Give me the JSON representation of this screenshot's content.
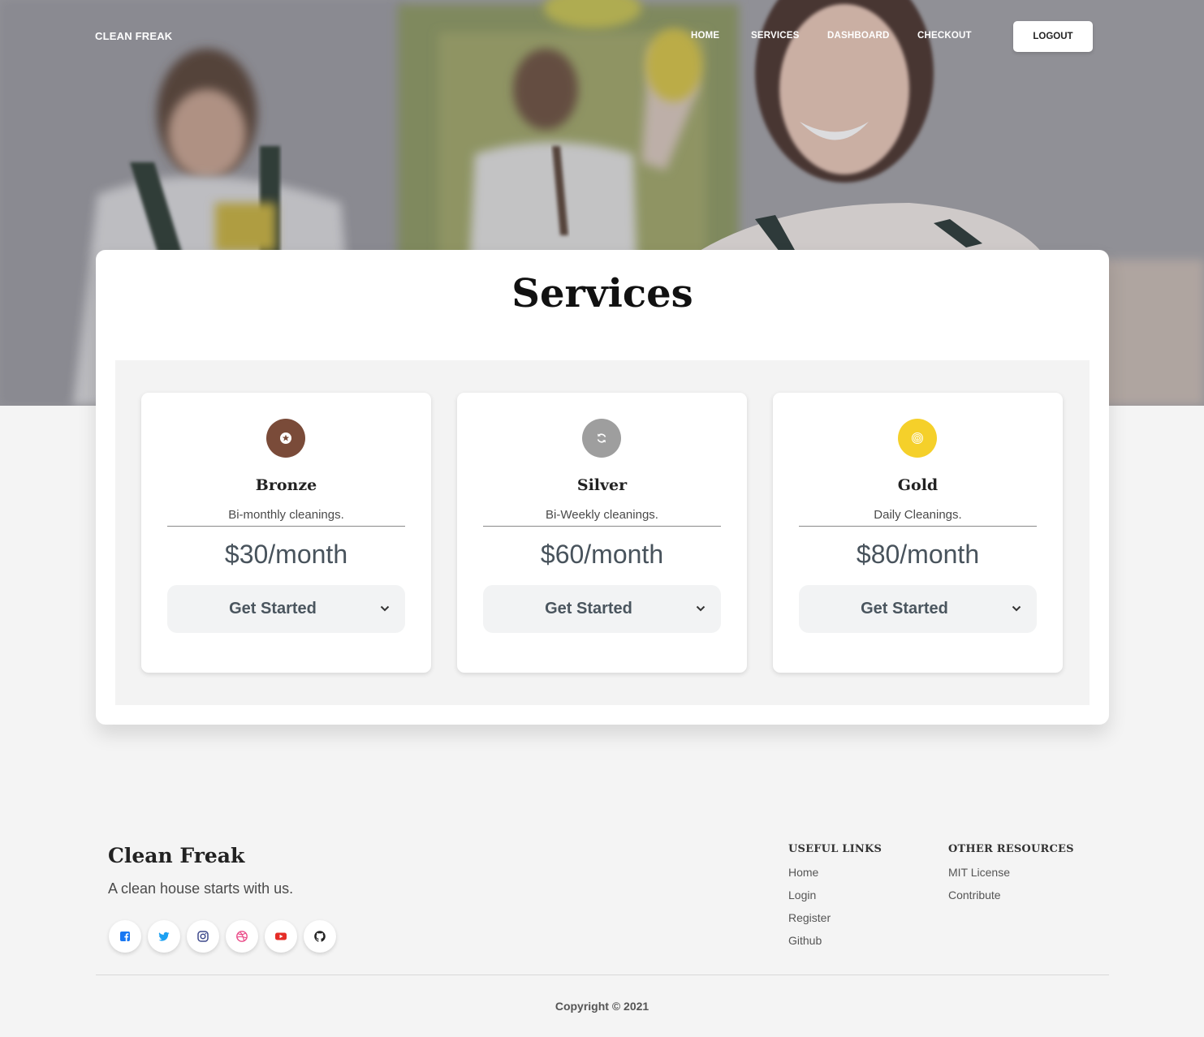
{
  "nav": {
    "brand": "CLEAN FREAK",
    "links": [
      "HOME",
      "SERVICES",
      "DASHBOARD",
      "CHECKOUT"
    ],
    "logout": "LOGOUT"
  },
  "hero": {
    "image": "cleaning-team-photo"
  },
  "services": {
    "title": "Services",
    "plans": [
      {
        "name": "Bronze",
        "description": "Bi-monthly cleanings.",
        "price": "$30/month",
        "cta": "Get Started",
        "icon": "star-icon",
        "color": "#7a4b39"
      },
      {
        "name": "Silver",
        "description": "Bi-Weekly cleanings.",
        "price": "$60/month",
        "cta": "Get Started",
        "icon": "refresh-icon",
        "color": "#9e9e9e"
      },
      {
        "name": "Gold",
        "description": "Daily Cleanings.",
        "price": "$80/month",
        "cta": "Get Started",
        "icon": "fingerprint-icon",
        "color": "#f5d02a"
      }
    ]
  },
  "footer": {
    "brand": "Clean Freak",
    "tagline": "A clean house starts with us.",
    "social": [
      {
        "icon": "facebook-icon",
        "color": "#3b5998"
      },
      {
        "icon": "twitter-icon",
        "color": "#1da1f2"
      },
      {
        "icon": "instagram-icon",
        "color": "#3f4a8c"
      },
      {
        "icon": "dribbble-icon",
        "color": "#ea4c89"
      },
      {
        "icon": "youtube-icon",
        "color": "#e52d27"
      },
      {
        "icon": "github-icon",
        "color": "#222222"
      }
    ],
    "useful_links": {
      "title": "USEFUL LINKS",
      "items": [
        "Home",
        "Login",
        "Register",
        "Github"
      ]
    },
    "other_resources": {
      "title": "OTHER RESOURCES",
      "items": [
        "MIT License",
        "Contribute"
      ]
    },
    "copyright": "Copyright © 2021"
  }
}
